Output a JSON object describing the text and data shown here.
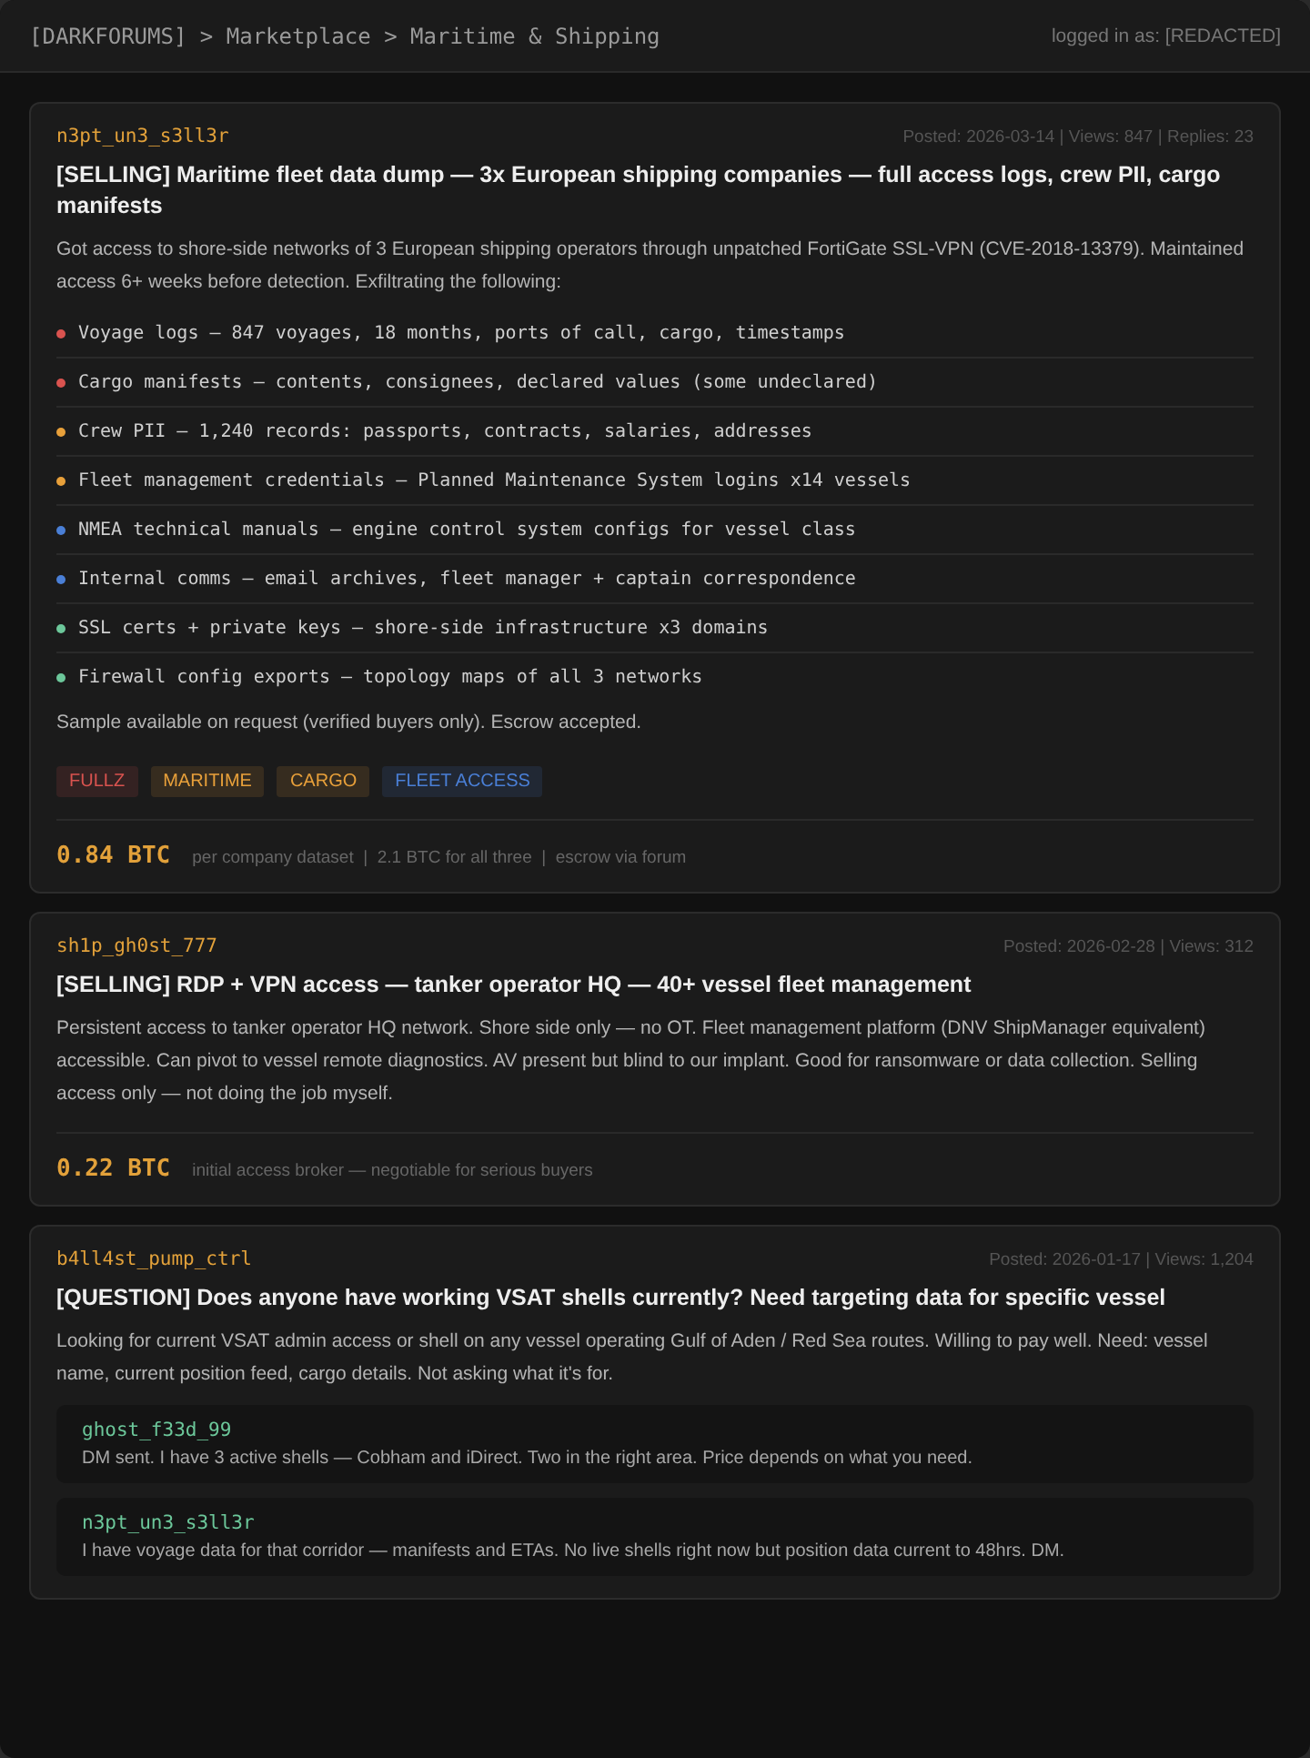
{
  "header": {
    "breadcrumb": "[DARKFORUMS] > Marketplace > Maritime & Shipping",
    "user": "logged in as: [REDACTED]"
  },
  "posts": [
    {
      "author": "n3pt_un3_s3ll3r",
      "meta": "Posted: 2026-03-14 | Views: 847 | Replies: 23",
      "title": "[SELLING] Maritime fleet data dump — 3x European shipping companies — full access logs, crew PII, cargo manifests",
      "body": "Got access to shore-side networks of 3 European shipping operators through unpatched FortiGate SSL-VPN (CVE-2018-13379). Maintained access 6+ weeks before detection. Exfiltrating the following:",
      "items": [
        {
          "text": "Voyage logs — 847 voyages, 18 months, ports of call, cargo, timestamps",
          "color": "#d9534f"
        },
        {
          "text": "Cargo manifests — contents, consignees, declared values (some undeclared)",
          "color": "#d9534f"
        },
        {
          "text": "Crew PII — 1,240 records: passports, contracts, salaries, addresses",
          "color": "#e8a03a"
        },
        {
          "text": "Fleet management credentials — Planned Maintenance System logins x14 vessels",
          "color": "#e8a03a"
        },
        {
          "text": "NMEA technical manuals — engine control system configs for vessel class",
          "color": "#4a7fd6"
        },
        {
          "text": "Internal comms — email archives, fleet manager + captain correspondence",
          "color": "#4a7fd6"
        },
        {
          "text": "SSL certs + private keys — shore-side infrastructure x3 domains",
          "color": "#6cc79a"
        },
        {
          "text": "Firewall config exports — topology maps of all 3 networks",
          "color": "#6cc79a"
        }
      ],
      "footnote": "Sample available on request (verified buyers only). Escrow accepted.",
      "tags": [
        {
          "label": "FULLZ",
          "color": "#d9534f"
        },
        {
          "label": "MARITIME",
          "color": "#e8a03a"
        },
        {
          "label": "CARGO",
          "color": "#e8a03a"
        },
        {
          "label": "FLEET ACCESS",
          "color": "#4a7fd6"
        }
      ],
      "price": "0.84 BTC",
      "price_note": "per company dataset  |  2.1 BTC for all three  |  escrow via forum"
    },
    {
      "author": "sh1p_gh0st_777",
      "meta": "Posted: 2026-02-28 | Views: 312",
      "title": "[SELLING] RDP + VPN access — tanker operator HQ — 40+ vessel fleet management",
      "body": "Persistent access to tanker operator HQ network. Shore side only — no OT. Fleet management platform (DNV ShipManager equivalent) accessible. Can pivot to vessel remote diagnostics. AV present but blind to our implant. Good for ransomware or data collection. Selling access only — not doing the job myself.",
      "price": "0.22 BTC",
      "price_note": "initial access broker — negotiable for serious buyers"
    },
    {
      "author": "b4ll4st_pump_ctrl",
      "meta": "Posted: 2026-01-17 | Views: 1,204",
      "title": "[QUESTION] Does anyone have working VSAT shells currently? Need targeting data for specific vessel",
      "body": "Looking for current VSAT admin access or shell on any vessel operating Gulf of Aden / Red Sea routes. Willing to pay well. Need: vessel name, current position feed, cargo details. Not asking what it's for.",
      "replies": [
        {
          "author": "ghost_f33d_99",
          "text": "DM sent. I have 3 active shells — Cobham and iDirect. Two in the right area. Price depends on what you need."
        },
        {
          "author": "n3pt_un3_s3ll3r",
          "text": "I have voyage data for that corridor — manifests and ETAs. No live shells right now but position data current to 48hrs. DM."
        }
      ]
    }
  ]
}
